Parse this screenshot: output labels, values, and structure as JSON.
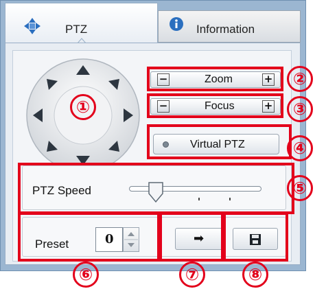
{
  "tabs": [
    {
      "label": "PTZ",
      "icon": "move-arrows-icon"
    },
    {
      "label": "Information",
      "icon": "info-icon"
    }
  ],
  "controls": {
    "zoom_label": "Zoom",
    "focus_label": "Focus",
    "minus_symbol": "−",
    "plus_symbol": "+",
    "virtual_ptz_label": "Virtual PTZ",
    "speed_label": "PTZ Speed",
    "speed_level": 0.2,
    "preset_label": "Preset",
    "preset_value": "0",
    "go_symbol": "➡",
    "save_icon": "save-icon"
  },
  "callouts": [
    "①",
    "②",
    "③",
    "④",
    "⑤",
    "⑥",
    "⑦",
    "⑧"
  ],
  "colors": {
    "callout": "#e3001b",
    "tab_icon": "#2b6fbf"
  }
}
